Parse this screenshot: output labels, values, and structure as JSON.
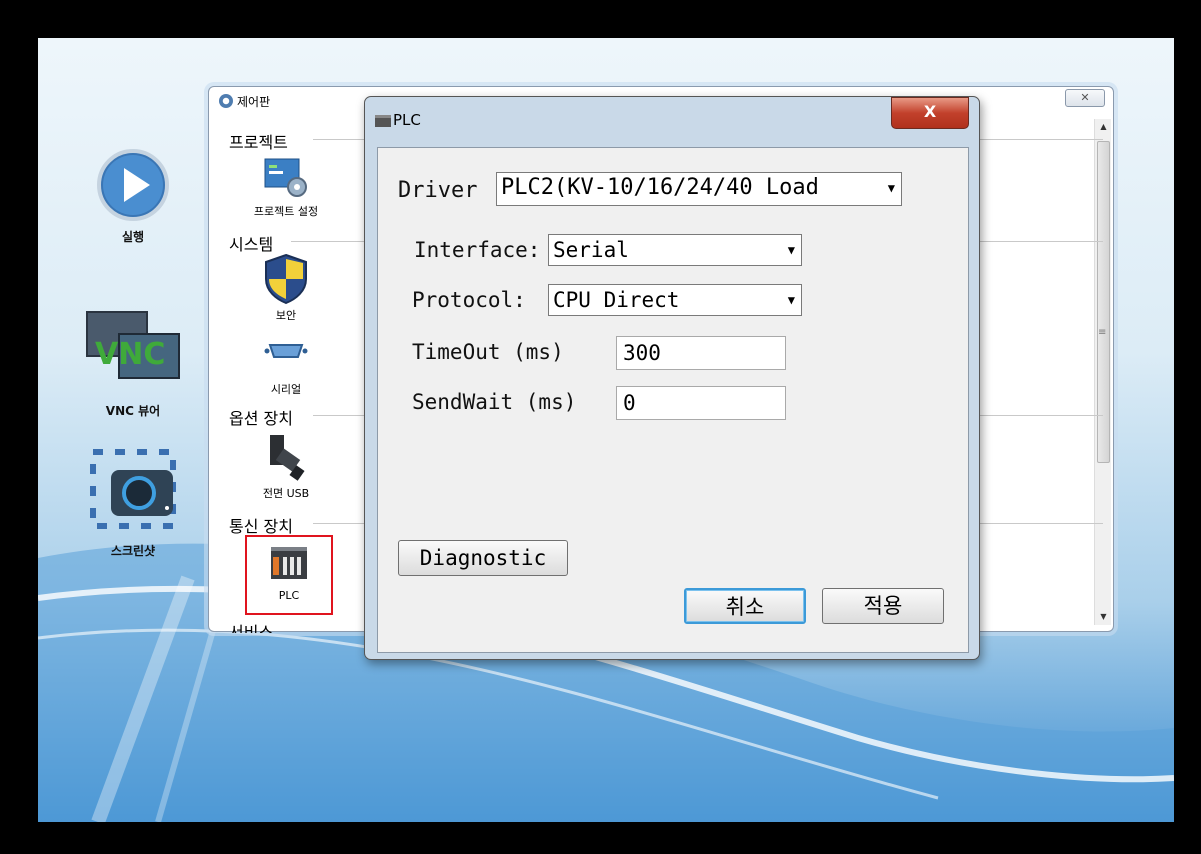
{
  "desktop": {
    "run_label": "실행",
    "vnc_label": "VNC 뷰어",
    "vnc_logo": "VNC",
    "screenshot_label": "스크린샷"
  },
  "control_panel": {
    "title": "제어판",
    "close_label": "✕",
    "sections": {
      "project": "프로젝트",
      "system": "시스템",
      "option_devices": "옵션 장치",
      "comm_devices": "통신 장치",
      "services": "서비스"
    },
    "items": {
      "project_settings": "프로젝트 설정",
      "security": "보안",
      "serial": "시리얼",
      "front_usb": "전면 USB",
      "plc": "PLC"
    }
  },
  "dialog": {
    "title": "PLC",
    "close_label": "X",
    "driver_label": "Driver",
    "driver_value": "PLC2(KV-10/16/24/40 Load",
    "interface_label": "Interface:",
    "interface_value": "Serial",
    "protocol_label": "Protocol:",
    "protocol_value": "CPU Direct",
    "timeout_label": "TimeOut (ms)",
    "timeout_value": "300",
    "sendwait_label": "SendWait (ms)",
    "sendwait_value": "0",
    "diagnostic_label": "Diagnostic",
    "cancel_label": "취소",
    "apply_label": "적용"
  },
  "colors": {
    "highlight_border": "#e0141e",
    "dialog_frame": "#c9d9e8",
    "cancel_focus": "#3c9ad8"
  }
}
